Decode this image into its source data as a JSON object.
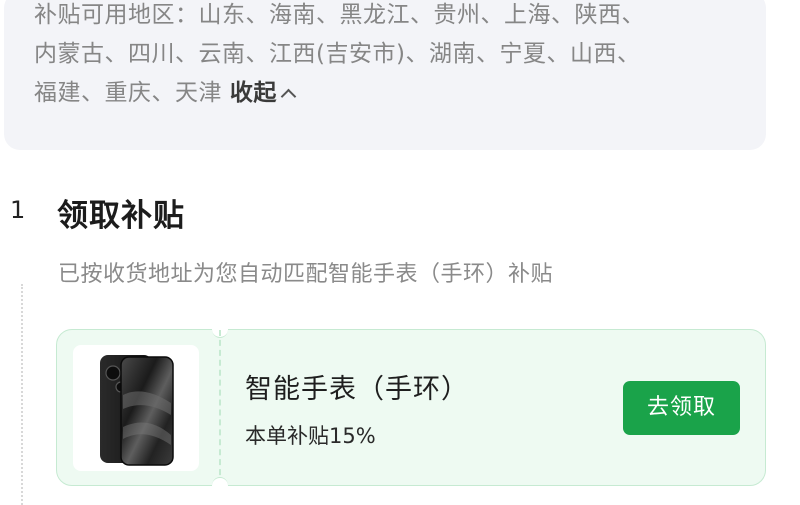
{
  "region_notice": {
    "line1": "补贴可用地区：山东、海南、黑龙江、贵州、上海、陕西、",
    "line2": "内蒙古、四川、云南、江西(吉安市)、湖南、宁夏、山西、",
    "line3_prefix": "福建、重庆、天津",
    "collapse_label": "收起"
  },
  "step": {
    "number": "1",
    "title": "领取补贴",
    "description": "已按收货地址为您自动匹配智能手表（手环）补贴"
  },
  "coupon": {
    "product_icon": "smartphone-image",
    "product_name": "智能手表（手环）",
    "subsidy_rate": "本单补贴15%",
    "claim_label": "去领取"
  },
  "colors": {
    "accent_green": "#1aa34a",
    "card_bg": "#eefaf2",
    "card_border": "#c6ead2",
    "notice_bg": "#f3f4f8"
  }
}
